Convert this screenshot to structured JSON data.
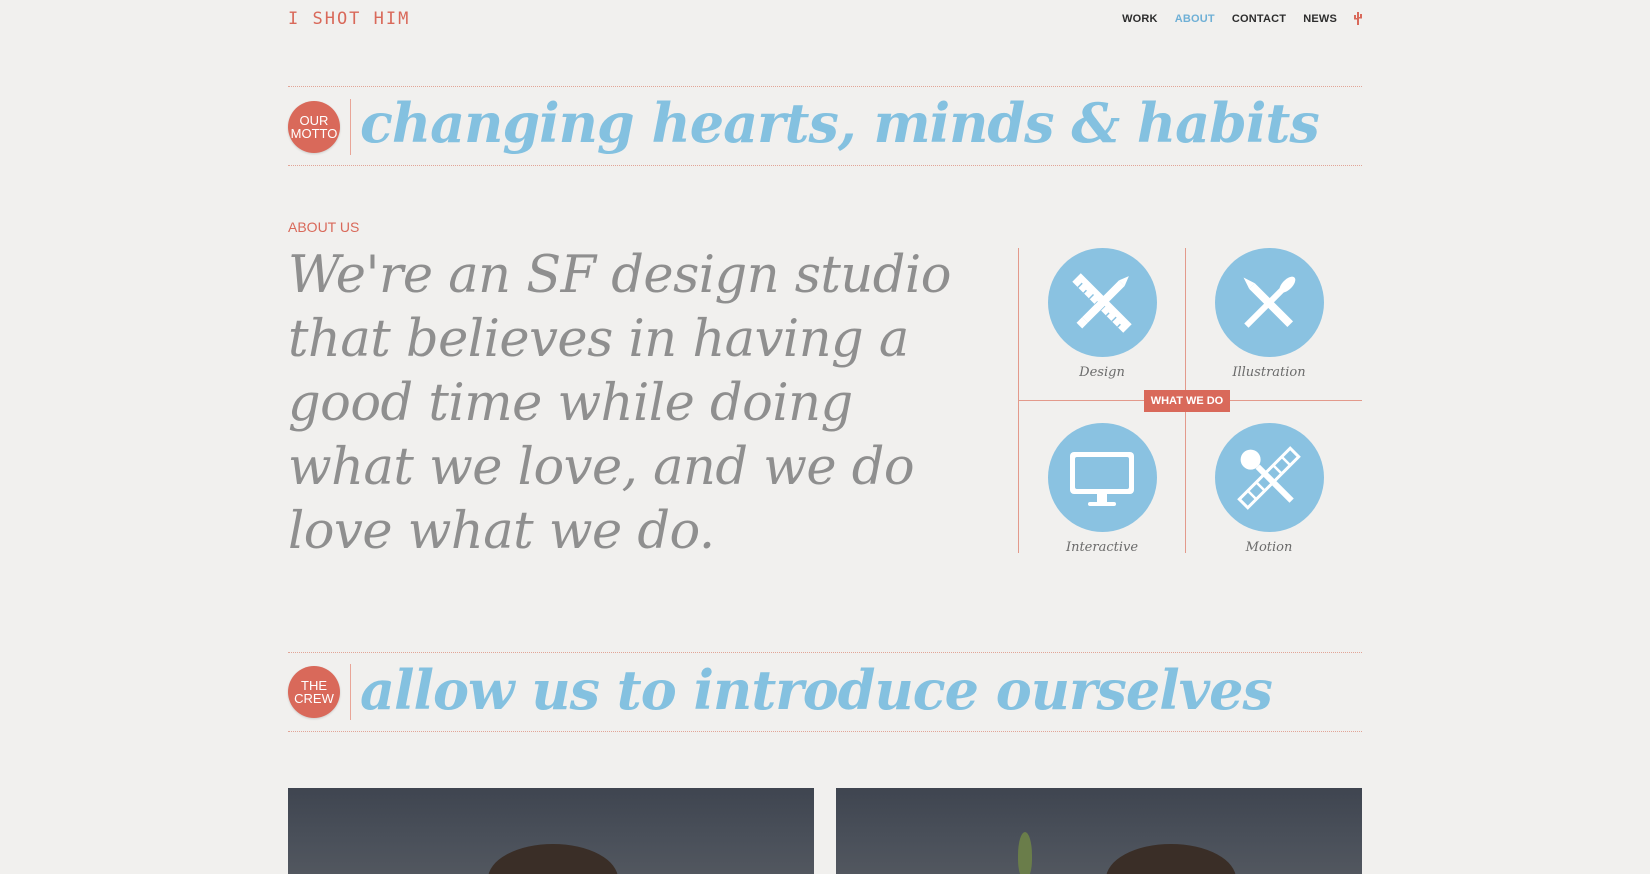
{
  "header": {
    "logo": "I SHOT HIM",
    "nav": [
      {
        "label": "WORK",
        "active": false
      },
      {
        "label": "ABOUT",
        "active": true
      },
      {
        "label": "CONTACT",
        "active": false
      },
      {
        "label": "NEWS",
        "active": false
      }
    ],
    "pin_icon": "cactus-icon"
  },
  "motto": {
    "badge_line1": "OUR",
    "badge_line2": "MOTTO",
    "headline": "changing hearts, minds & habits"
  },
  "about": {
    "label": "ABOUT US",
    "lines": [
      "We're an SF design studio",
      "that believes in having a",
      "good time while doing",
      "what we love, and we do",
      "love what we do."
    ]
  },
  "what_we_do": {
    "tag": "WHAT WE DO",
    "items": [
      {
        "label": "Design",
        "icon": "ruler-pencil-icon"
      },
      {
        "label": "Illustration",
        "icon": "brush-pen-icon"
      },
      {
        "label": "Interactive",
        "icon": "monitor-icon"
      },
      {
        "label": "Motion",
        "icon": "film-microphone-icon"
      }
    ]
  },
  "crew": {
    "badge_line1": "THE",
    "badge_line2": "CREW",
    "headline": "allow us to introduce ourselves"
  },
  "colors": {
    "accent_red": "#d9695a",
    "accent_blue": "#84c1e0",
    "text_gray": "#8f8f8f",
    "background": "#f1f0ee"
  }
}
